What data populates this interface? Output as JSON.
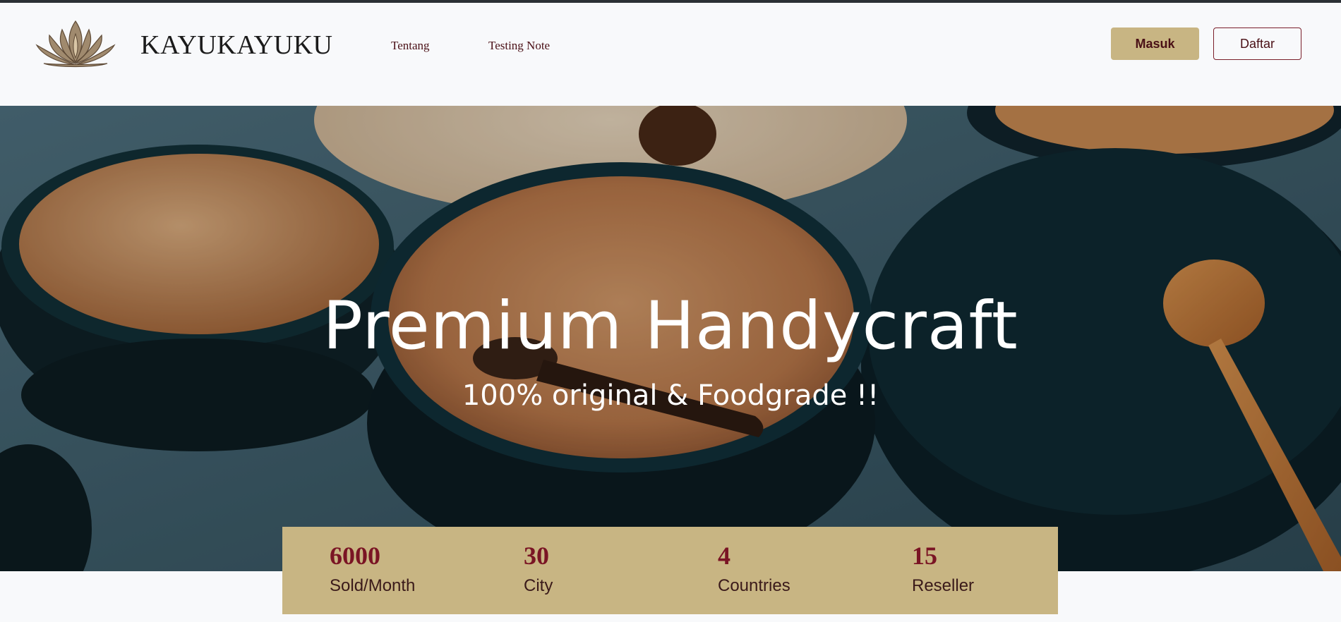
{
  "navbar": {
    "logo_icon": "lotus-icon",
    "brand": "KAYUKAYUKU",
    "links": [
      "Tentang",
      "Testing Note"
    ],
    "login_label": "Masuk",
    "register_label": "Daftar"
  },
  "hero": {
    "title": "Premium Handycraft",
    "subtitle": "100% original & Foodgrade !!"
  },
  "stats": [
    {
      "value": "6000",
      "label": "Sold/Month"
    },
    {
      "value": "30",
      "label": "City"
    },
    {
      "value": "4",
      "label": "Countries"
    },
    {
      "value": "15",
      "label": "Reseller"
    }
  ],
  "colors": {
    "accent": "#c8b583",
    "maroon": "#7a1424",
    "background": "#f8f9fb"
  }
}
